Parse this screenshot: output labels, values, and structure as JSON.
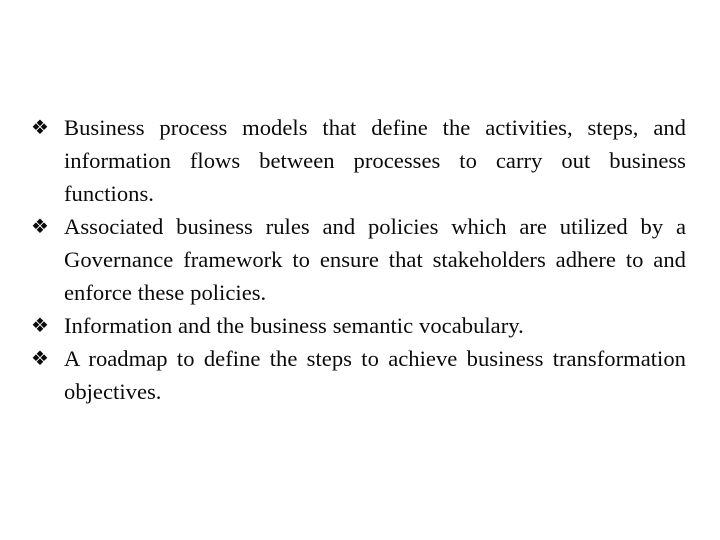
{
  "slide": {
    "background_color": "#ffffff",
    "text_color": "#0a0a0a",
    "bullet_glyph": "❖",
    "bullet_icon_name": "lozenge-cluster-bullet-icon",
    "items": [
      {
        "text": "Business process models that define the activities, steps, and information flows between processes to carry out business functions."
      },
      {
        "text": "Associated business rules and policies which are utilized by a Governance framework to ensure that stakeholders adhere to and enforce these policies."
      },
      {
        "text": "Information and the business semantic vocabulary."
      },
      {
        "text": "A roadmap to define the steps to achieve business transformation objectives."
      }
    ]
  }
}
